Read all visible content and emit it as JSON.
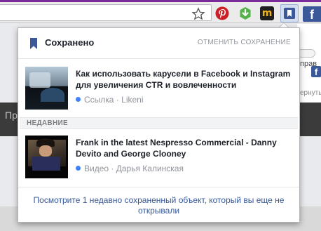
{
  "browser": {
    "extensions": [
      {
        "name": "pinterest"
      },
      {
        "name": "green-arrow"
      },
      {
        "name": "m",
        "letter": "m"
      },
      {
        "name": "facebook-save"
      },
      {
        "name": "facebook",
        "letter": "f"
      }
    ]
  },
  "background_page": {
    "fragment_right": "прав",
    "fragment_fb": "f",
    "fragment_ternu": "ернуть",
    "fragment_left": "Пр"
  },
  "popup": {
    "title": "Сохранено",
    "unsave_label": "ОТМЕНИТЬ СОХРАНЕНИЕ",
    "items": [
      {
        "title": "Как использовать карусели в Facebook и Instagram для увеличения CTR и вовлеченности",
        "type": "Ссылка",
        "separator": " · ",
        "source": "Likeni"
      }
    ],
    "recent_label": "НЕДАВНИЕ",
    "recent_items": [
      {
        "title": "Frank in the latest Nespresso Commercial - Danny Devito and George Clooney",
        "type": "Видео",
        "separator": " · ",
        "source": "Дарья Калинская"
      }
    ],
    "footer_link": "Посмотрите 1 недавно сохраненный объект, который вы еще не открывали"
  },
  "colors": {
    "facebook_blue": "#3b5998",
    "link_blue": "#365899",
    "dot_blue": "#4080ff",
    "chrome_purple": "#7a2a9a"
  }
}
